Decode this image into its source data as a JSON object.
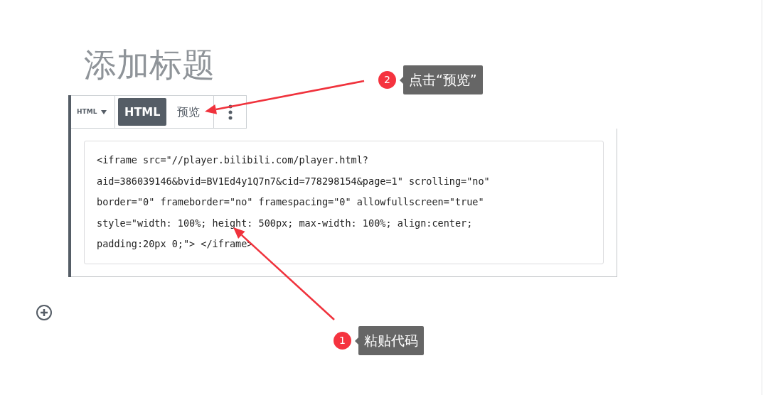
{
  "title": "添加标题",
  "block": {
    "type_menu": "HTML",
    "tabs": [
      {
        "label": "HTML",
        "selected": true
      },
      {
        "label": "预览",
        "selected": false
      }
    ],
    "code_lines": [
      "<iframe src=\"//player.bilibili.com/player.html?",
      "aid=386039146&bvid=BV1Ed4y1Q7n7&cid=778298154&page=1\" scrolling=\"no\"",
      "border=\"0\" frameborder=\"no\" framespacing=\"0\" allowfullscreen=\"true\"",
      "style=\"width: 100%; height: 500px; max-width: 100%; align:center;",
      "padding:20px 0;\"> </iframe>"
    ]
  },
  "annotations": [
    {
      "number": "2",
      "text": "点击“预览”"
    },
    {
      "number": "1",
      "text": "粘贴代码"
    }
  ]
}
